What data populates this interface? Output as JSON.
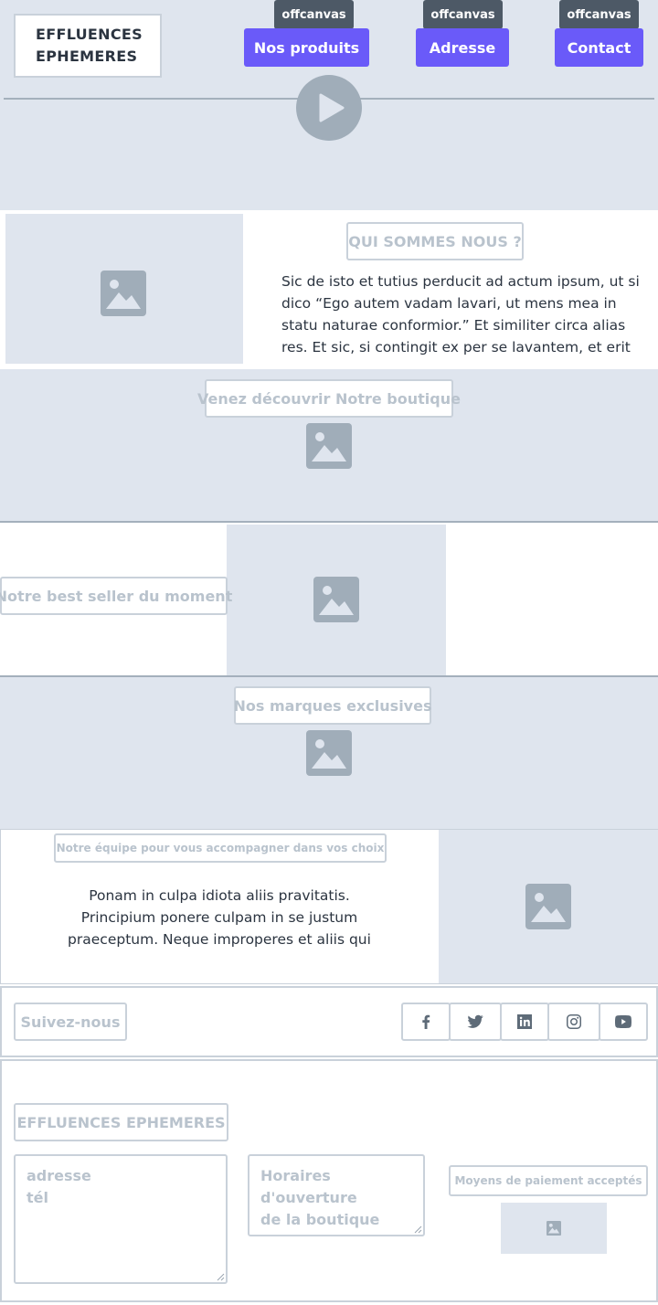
{
  "header": {
    "logo_line1": "EFFLUENCES",
    "logo_line2": "EPHEMERES",
    "nav": [
      {
        "label": "Nos produits",
        "tooltip": "offcanvas"
      },
      {
        "label": "Adresse",
        "tooltip": "offcanvas"
      },
      {
        "label": "Contact",
        "tooltip": "offcanvas"
      }
    ]
  },
  "about": {
    "heading": "QUI SOMMES NOUS ?",
    "text": "Sic de isto et tutius perducit ad actum ipsum, ut si dico “Ego autem vadam lavari, ut mens mea in statu naturae conformior.” Et similiter circa alias res. Et sic, si contingit ex per se lavantem, et erit"
  },
  "boutique": {
    "heading": "Venez découvrir Notre boutique"
  },
  "bestseller": {
    "heading": "Notre best seller du moment"
  },
  "marques": {
    "heading": "Nos marques exclusives"
  },
  "equipe": {
    "heading": "Notre équipe pour vous accompagner dans vos choix",
    "text": "Ponam in culpa idiota aliis pravitatis. Principium ponere culpam in se justum praeceptum. Neque improperes et aliis qui"
  },
  "social": {
    "label": "Suivez-nous",
    "icons": [
      "facebook-icon",
      "twitter-icon",
      "linkedin-icon",
      "instagram-icon",
      "youtube-icon"
    ]
  },
  "footer": {
    "brand": "EFFLUENCES EPHEMERES",
    "address_text": "adresse\ntél",
    "hours_text": "Horaires d'ouverture\nde la boutique",
    "payment_label": "Moyens de paiement acceptés"
  },
  "colors": {
    "accent": "#6a5af9",
    "tooltip": "#4d5966",
    "section_bg": "#dfe5ee",
    "border": "#c9d1da",
    "icon_gray": "#a0adb9"
  }
}
